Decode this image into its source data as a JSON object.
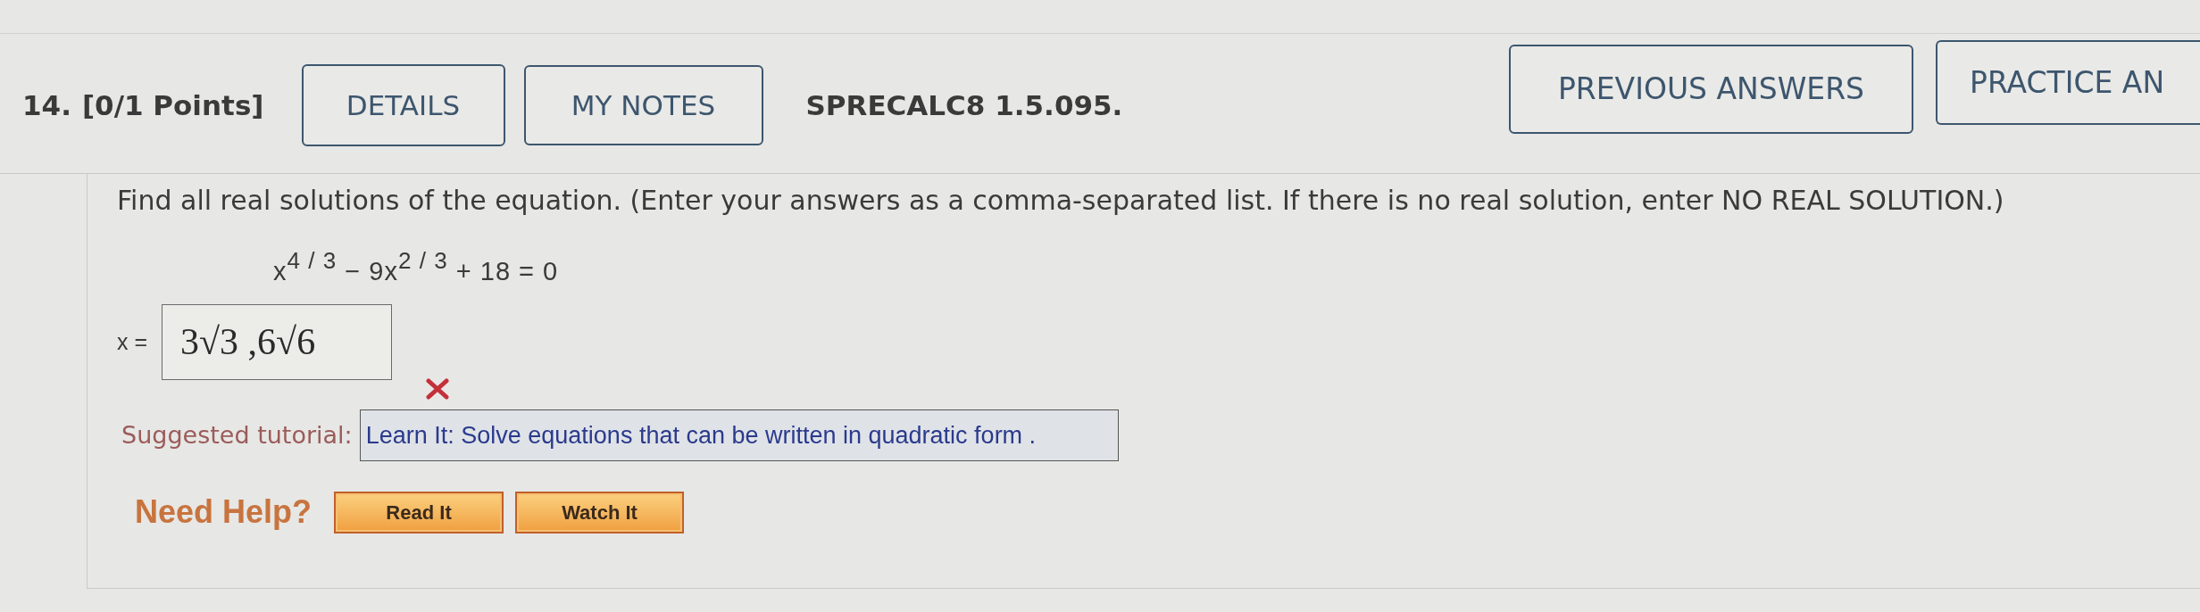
{
  "question": {
    "number": "14.",
    "points": "[0/1 Points]",
    "buttons": [
      {
        "label": "DETAILS"
      },
      {
        "label": "MY NOTES"
      }
    ],
    "code": "SPRECALC8 1.5.095.",
    "right_buttons": [
      {
        "label": "PREVIOUS ANSWERS"
      },
      {
        "label": "PRACTICE AN"
      }
    ]
  },
  "instruction": "Find all real solutions of the equation. (Enter your answers as a comma-separated list. If there is no real solution, enter NO REAL SOLUTION.)",
  "equation": "x$^{4 / 3}$ − 9x$^{2 / 3}$ + 18 = 0",
  "answer": {
    "label": "x =",
    "value": "3√3 ,6√6",
    "correct": false
  },
  "tutorial": {
    "label": "Suggested tutorial:",
    "link": "Learn It: Solve equations that can be written in quadratic form ."
  },
  "help": {
    "label": "Need Help?",
    "buttons": [
      {
        "label": "Read It"
      },
      {
        "label": "Watch It"
      }
    ]
  }
}
